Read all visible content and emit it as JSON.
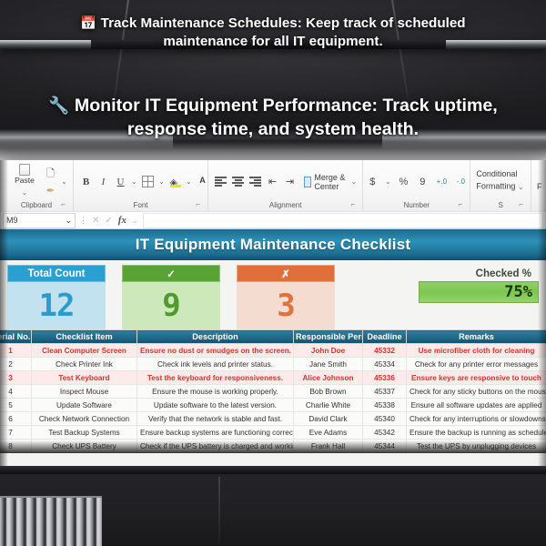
{
  "captions": [
    {
      "icon": "calendar-icon",
      "glyph": "📅",
      "text": "Track Maintenance Schedules: Keep track of scheduled maintenance for all IT equipment."
    },
    {
      "icon": "wrench-icon",
      "glyph": "🔧",
      "text": "Monitor IT Equipment Performance: Track uptime, response time, and system health."
    }
  ],
  "ribbon": {
    "clipboard": {
      "group_label": "Clipboard",
      "paste_label": "Paste",
      "dialog_launcher": "⌐"
    },
    "font": {
      "group_label": "Font",
      "bold": "B",
      "italic": "I",
      "underline": "U",
      "borders": "borders",
      "fill_color": "fill-color",
      "font_color": "A",
      "dropdown": "⌄",
      "dialog_launcher": "⌐"
    },
    "alignment": {
      "group_label": "Alignment",
      "merge_label": "Merge & Center",
      "dropdown": "⌄",
      "dialog_launcher": "⌐"
    },
    "number": {
      "group_label": "Number",
      "currency": "$",
      "percent": "%",
      "comma": "9",
      "increase_decimal": "+.0",
      "decrease_decimal": "-.0",
      "dropdown": "⌄",
      "dialog_launcher": "⌐"
    },
    "styles": {
      "group_label": "S",
      "conditional_formatting": "Conditional Formatting",
      "dropdown": "⌄",
      "next_partial": "F"
    }
  },
  "formula_bar": {
    "name_box_value": "M9",
    "name_box_arrow": "⌄",
    "more_dots": "⋮",
    "cancel": "✕",
    "confirm": "✓",
    "fx": "fx",
    "fx_arrow": "⌄",
    "formula_value": "",
    "formula_placeholder": ""
  },
  "sheet": {
    "title": "IT Equipment Maintenance Checklist",
    "kpis": [
      {
        "name": "total-count",
        "header": "Total Count",
        "value": "12",
        "header_color": "#2a9fd0",
        "body_color": "#c3e2ef",
        "value_color": "#2b9ccb"
      },
      {
        "name": "checked-count",
        "header": "✓",
        "value": "9",
        "header_color": "#58a333",
        "body_color": "#cde9bc",
        "value_color": "#4f9b2e"
      },
      {
        "name": "unchecked-count",
        "header": "✗",
        "value": "3",
        "header_color": "#e0703a",
        "body_color": "#f4dcd1",
        "value_color": "#e2713c"
      }
    ],
    "checked_percent": {
      "label": "Checked %",
      "value": "75%"
    }
  },
  "table": {
    "headers": [
      "Serial No.",
      "Checklist Item",
      "Description",
      "Responsible Person",
      "Deadline",
      "Remarks"
    ],
    "rows": [
      {
        "serial": "1",
        "item": "Clean Computer Screen",
        "description": "Ensure no dust or smudges on the screen.",
        "person": "John Doe",
        "deadline": "45332",
        "remarks": "Use microfiber cloth for cleaning",
        "highlight": true
      },
      {
        "serial": "2",
        "item": "Check Printer Ink",
        "description": "Check ink levels and printer status.",
        "person": "Jane Smith",
        "deadline": "45334",
        "remarks": "Check for any printer error messages",
        "highlight": false
      },
      {
        "serial": "3",
        "item": "Test Keyboard",
        "description": "Test the keyboard for responsiveness.",
        "person": "Alice Johnson",
        "deadline": "45336",
        "remarks": "Ensure keys are responsive to touch",
        "highlight": true
      },
      {
        "serial": "4",
        "item": "Inspect Mouse",
        "description": "Ensure the mouse is working properly.",
        "person": "Bob Brown",
        "deadline": "45337",
        "remarks": "Check for any sticky buttons on the mouse",
        "highlight": false
      },
      {
        "serial": "5",
        "item": "Update Software",
        "description": "Update software to the latest version.",
        "person": "Charlie White",
        "deadline": "45338",
        "remarks": "Ensure all software updates are applied",
        "highlight": false
      },
      {
        "serial": "6",
        "item": "Check Network Connection",
        "description": "Verify that the network is stable and fast.",
        "person": "David Clark",
        "deadline": "45340",
        "remarks": "Check for any interruptions or slowdowns",
        "highlight": false
      },
      {
        "serial": "7",
        "item": "Test Backup Systems",
        "description": "Ensure backup systems are functioning correctly.",
        "person": "Eve Adams",
        "deadline": "45342",
        "remarks": "Ensure the backup is running as scheduled",
        "highlight": false
      },
      {
        "serial": "8",
        "item": "Check UPS Battery",
        "description": "Check if the UPS battery is charged and working.",
        "person": "Frank Hall",
        "deadline": "45344",
        "remarks": "Test the UPS by unplugging devices",
        "highlight": false
      }
    ]
  }
}
